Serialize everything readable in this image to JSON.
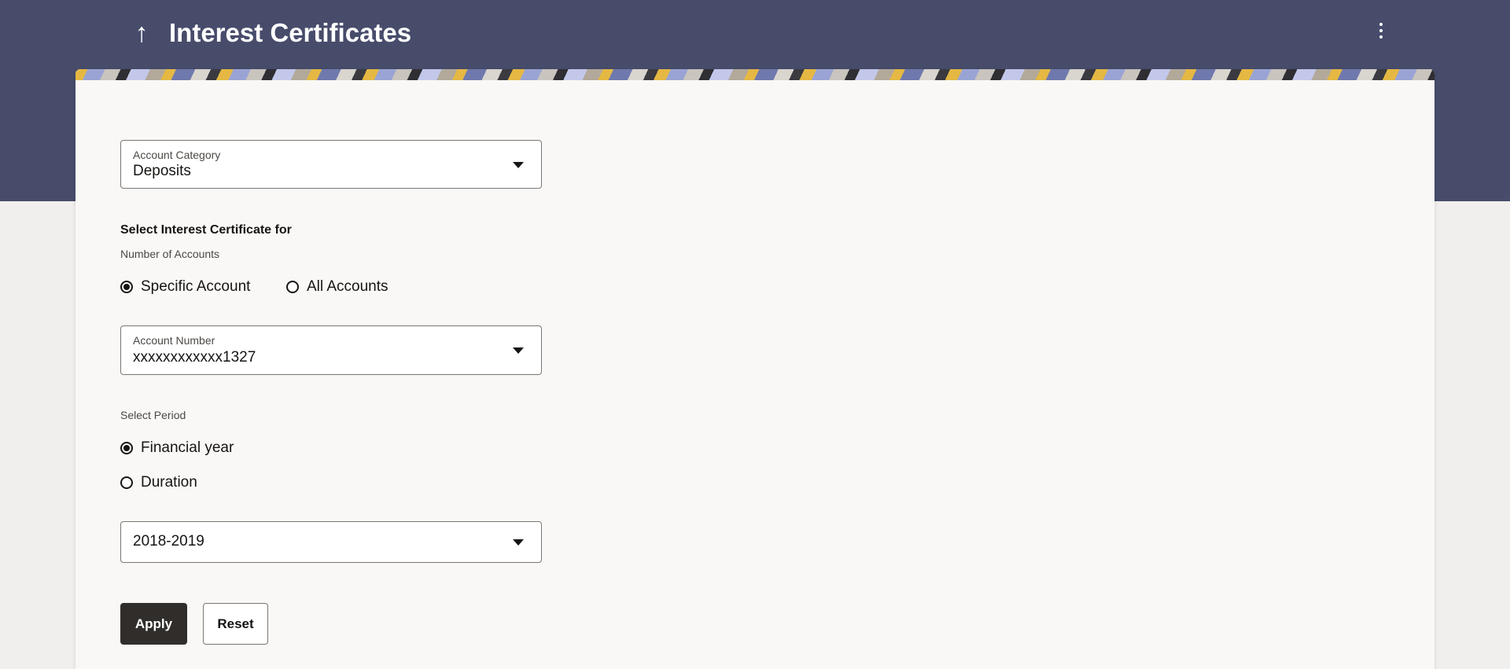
{
  "header": {
    "title": "Interest Certificates",
    "back_icon": "arrow-up-icon",
    "menu_icon": "kebab-menu-icon",
    "band_color": "#474c6b"
  },
  "form": {
    "account_category": {
      "label": "Account Category",
      "value": "Deposits"
    },
    "section_heading": "Select Interest Certificate for",
    "number_of_accounts": {
      "label": "Number of Accounts",
      "options": [
        "Specific Account",
        "All Accounts"
      ],
      "selected": "Specific Account"
    },
    "account_number": {
      "label": "Account Number",
      "value": "xxxxxxxxxxxx1327"
    },
    "select_period": {
      "label": "Select Period",
      "options": [
        "Financial year",
        "Duration"
      ],
      "selected": "Financial year"
    },
    "financial_year": {
      "value": "2018-2019"
    }
  },
  "actions": {
    "apply_label": "Apply",
    "reset_label": "Reset",
    "primary_color": "#312d2a"
  }
}
